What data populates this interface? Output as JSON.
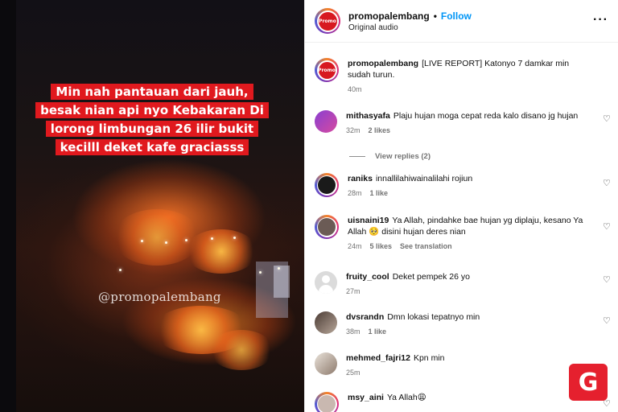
{
  "media": {
    "caption_lines": [
      "Min nah pantauan dari jauh,",
      "besak nian api nyo Kebakaran Di",
      "lorong limbungan 26 ilir bukit",
      "kecilll deket kafe graciasss"
    ],
    "watermark": "@promopalembang"
  },
  "header": {
    "username": "promopalembang",
    "separator": "•",
    "follow_label": "Follow",
    "audio_label": "Original audio",
    "more_icon": "more-horizontal-icon",
    "avatar_logo_text": "Promo"
  },
  "caption_post": {
    "username": "promopalembang",
    "text": "[LIVE REPORT] Katonyo 7 damkar min sudah turun.",
    "time": "40m"
  },
  "comments": [
    {
      "username": "mithasyafa",
      "text": "Plaju hujan moga cepat reda kalo disano jg hujan",
      "time": "32m",
      "likes": "2 likes",
      "extra": ""
    },
    {
      "username": "raniks",
      "text": "innallilahiwainalilahi rojiun",
      "time": "28m",
      "likes": "1 like",
      "extra": ""
    },
    {
      "username": "uisnaini19",
      "text": "Ya Allah, pindahke bae hujan yg diplaju, kesano Ya Allah 🥺 disini hujan deres nian",
      "time": "24m",
      "likes": "5 likes",
      "extra": "See translation"
    },
    {
      "username": "fruity_cool",
      "text": "Deket pempek 26 yo",
      "time": "27m",
      "likes": "",
      "extra": ""
    },
    {
      "username": "dvsrandn",
      "text": "Dmn lokasi tepatnyo min",
      "time": "38m",
      "likes": "1 like",
      "extra": ""
    },
    {
      "username": "mehmed_fajri12",
      "text": "Kpn min",
      "time": "25m",
      "likes": "",
      "extra": ""
    },
    {
      "username": "msy_aini",
      "text": "Ya Allah😩",
      "time": "",
      "likes": "",
      "extra": ""
    }
  ],
  "view_replies_label": "View replies (2)",
  "badge_letter": "G",
  "colors": {
    "caption_bg": "#e0191e",
    "follow": "#0095f6",
    "badge": "#e5202e"
  }
}
